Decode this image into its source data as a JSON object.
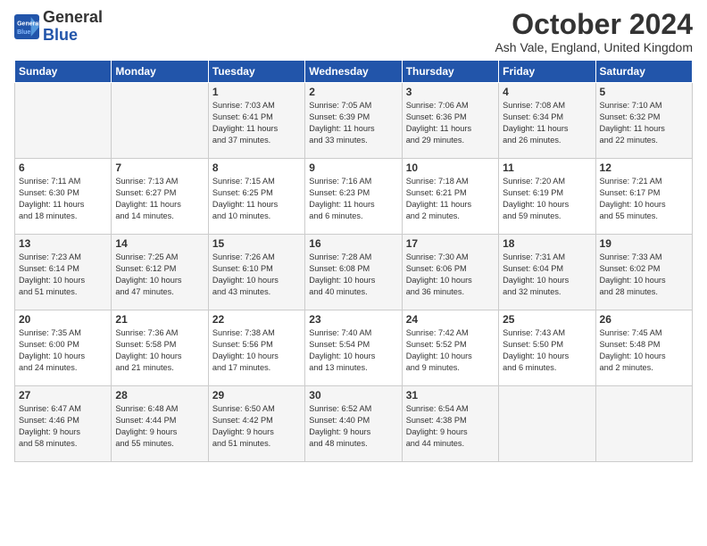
{
  "logo": {
    "line1": "General",
    "line2": "Blue"
  },
  "title": "October 2024",
  "location": "Ash Vale, England, United Kingdom",
  "days_header": [
    "Sunday",
    "Monday",
    "Tuesday",
    "Wednesday",
    "Thursday",
    "Friday",
    "Saturday"
  ],
  "weeks": [
    [
      {
        "day": "",
        "content": ""
      },
      {
        "day": "",
        "content": ""
      },
      {
        "day": "1",
        "content": "Sunrise: 7:03 AM\nSunset: 6:41 PM\nDaylight: 11 hours\nand 37 minutes."
      },
      {
        "day": "2",
        "content": "Sunrise: 7:05 AM\nSunset: 6:39 PM\nDaylight: 11 hours\nand 33 minutes."
      },
      {
        "day": "3",
        "content": "Sunrise: 7:06 AM\nSunset: 6:36 PM\nDaylight: 11 hours\nand 29 minutes."
      },
      {
        "day": "4",
        "content": "Sunrise: 7:08 AM\nSunset: 6:34 PM\nDaylight: 11 hours\nand 26 minutes."
      },
      {
        "day": "5",
        "content": "Sunrise: 7:10 AM\nSunset: 6:32 PM\nDaylight: 11 hours\nand 22 minutes."
      }
    ],
    [
      {
        "day": "6",
        "content": "Sunrise: 7:11 AM\nSunset: 6:30 PM\nDaylight: 11 hours\nand 18 minutes."
      },
      {
        "day": "7",
        "content": "Sunrise: 7:13 AM\nSunset: 6:27 PM\nDaylight: 11 hours\nand 14 minutes."
      },
      {
        "day": "8",
        "content": "Sunrise: 7:15 AM\nSunset: 6:25 PM\nDaylight: 11 hours\nand 10 minutes."
      },
      {
        "day": "9",
        "content": "Sunrise: 7:16 AM\nSunset: 6:23 PM\nDaylight: 11 hours\nand 6 minutes."
      },
      {
        "day": "10",
        "content": "Sunrise: 7:18 AM\nSunset: 6:21 PM\nDaylight: 11 hours\nand 2 minutes."
      },
      {
        "day": "11",
        "content": "Sunrise: 7:20 AM\nSunset: 6:19 PM\nDaylight: 10 hours\nand 59 minutes."
      },
      {
        "day": "12",
        "content": "Sunrise: 7:21 AM\nSunset: 6:17 PM\nDaylight: 10 hours\nand 55 minutes."
      }
    ],
    [
      {
        "day": "13",
        "content": "Sunrise: 7:23 AM\nSunset: 6:14 PM\nDaylight: 10 hours\nand 51 minutes."
      },
      {
        "day": "14",
        "content": "Sunrise: 7:25 AM\nSunset: 6:12 PM\nDaylight: 10 hours\nand 47 minutes."
      },
      {
        "day": "15",
        "content": "Sunrise: 7:26 AM\nSunset: 6:10 PM\nDaylight: 10 hours\nand 43 minutes."
      },
      {
        "day": "16",
        "content": "Sunrise: 7:28 AM\nSunset: 6:08 PM\nDaylight: 10 hours\nand 40 minutes."
      },
      {
        "day": "17",
        "content": "Sunrise: 7:30 AM\nSunset: 6:06 PM\nDaylight: 10 hours\nand 36 minutes."
      },
      {
        "day": "18",
        "content": "Sunrise: 7:31 AM\nSunset: 6:04 PM\nDaylight: 10 hours\nand 32 minutes."
      },
      {
        "day": "19",
        "content": "Sunrise: 7:33 AM\nSunset: 6:02 PM\nDaylight: 10 hours\nand 28 minutes."
      }
    ],
    [
      {
        "day": "20",
        "content": "Sunrise: 7:35 AM\nSunset: 6:00 PM\nDaylight: 10 hours\nand 24 minutes."
      },
      {
        "day": "21",
        "content": "Sunrise: 7:36 AM\nSunset: 5:58 PM\nDaylight: 10 hours\nand 21 minutes."
      },
      {
        "day": "22",
        "content": "Sunrise: 7:38 AM\nSunset: 5:56 PM\nDaylight: 10 hours\nand 17 minutes."
      },
      {
        "day": "23",
        "content": "Sunrise: 7:40 AM\nSunset: 5:54 PM\nDaylight: 10 hours\nand 13 minutes."
      },
      {
        "day": "24",
        "content": "Sunrise: 7:42 AM\nSunset: 5:52 PM\nDaylight: 10 hours\nand 9 minutes."
      },
      {
        "day": "25",
        "content": "Sunrise: 7:43 AM\nSunset: 5:50 PM\nDaylight: 10 hours\nand 6 minutes."
      },
      {
        "day": "26",
        "content": "Sunrise: 7:45 AM\nSunset: 5:48 PM\nDaylight: 10 hours\nand 2 minutes."
      }
    ],
    [
      {
        "day": "27",
        "content": "Sunrise: 6:47 AM\nSunset: 4:46 PM\nDaylight: 9 hours\nand 58 minutes."
      },
      {
        "day": "28",
        "content": "Sunrise: 6:48 AM\nSunset: 4:44 PM\nDaylight: 9 hours\nand 55 minutes."
      },
      {
        "day": "29",
        "content": "Sunrise: 6:50 AM\nSunset: 4:42 PM\nDaylight: 9 hours\nand 51 minutes."
      },
      {
        "day": "30",
        "content": "Sunrise: 6:52 AM\nSunset: 4:40 PM\nDaylight: 9 hours\nand 48 minutes."
      },
      {
        "day": "31",
        "content": "Sunrise: 6:54 AM\nSunset: 4:38 PM\nDaylight: 9 hours\nand 44 minutes."
      },
      {
        "day": "",
        "content": ""
      },
      {
        "day": "",
        "content": ""
      }
    ]
  ]
}
